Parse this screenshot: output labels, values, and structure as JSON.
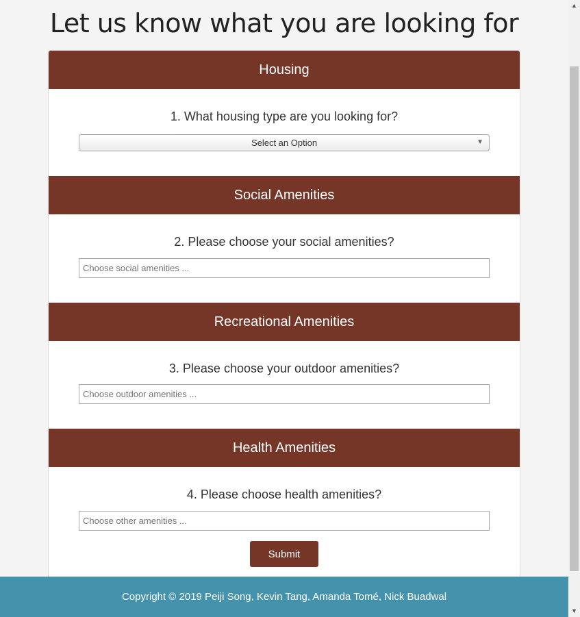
{
  "page": {
    "title": "Let us know what you are looking for"
  },
  "sections": [
    {
      "header": "Housing",
      "question": "1. What housing type are you looking for?",
      "select_value": "Select an Option"
    },
    {
      "header": "Social Amenities",
      "question": "2. Please choose your social amenities?",
      "placeholder": "Choose social amenities ..."
    },
    {
      "header": "Recreational Amenities",
      "question": "3. Please choose your outdoor amenities?",
      "placeholder": "Choose outdoor amenities ..."
    },
    {
      "header": "Health Amenities",
      "question": "4. Please choose health amenities?",
      "placeholder": "Choose other amenities ..."
    }
  ],
  "submit_label": "Submit",
  "footer": {
    "text": "Copyright © 2019 Peiji Song, Kevin Tang, Amanda Tomé, Nick Buadwal"
  },
  "colors": {
    "header_bg": "#763627",
    "footer_bg": "#4592ad",
    "page_bg": "#f4f4f4"
  },
  "icons": {
    "select_arrow": "triangle-down-icon",
    "scroll_up": "scroll-up-arrow-icon",
    "scroll_down": "scroll-down-arrow-icon"
  }
}
